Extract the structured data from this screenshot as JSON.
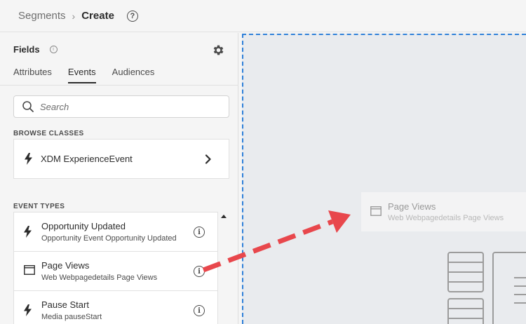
{
  "breadcrumb": {
    "parent": "Segments",
    "separator": "›",
    "current": "Create"
  },
  "fields": {
    "title": "Fields",
    "tabs": [
      {
        "label": "Attributes",
        "active": false
      },
      {
        "label": "Events",
        "active": true
      },
      {
        "label": "Audiences",
        "active": false
      }
    ],
    "search_placeholder": "Search",
    "browse_classes_label": "BROWSE CLASSES",
    "class_item": {
      "label": "XDM ExperienceEvent",
      "icon": "lightning-icon"
    },
    "event_types_label": "EVENT TYPES",
    "event_types": [
      {
        "title": "Opportunity Updated",
        "subtitle": "Opportunity Event Opportunity Updated",
        "icon": "lightning-icon"
      },
      {
        "title": "Page Views",
        "subtitle": "Web Webpagedetails Page Views",
        "icon": "window-icon"
      },
      {
        "title": "Pause Start",
        "subtitle": "Media pauseStart",
        "icon": "lightning-icon"
      }
    ]
  },
  "canvas": {
    "drag_ghost": {
      "title": "Page Views",
      "subtitle": "Web Webpagedetails Page Views",
      "icon": "window-icon"
    }
  },
  "colors": {
    "drop_zone_border": "#2f80d9",
    "annotation_arrow": "#e8474c",
    "canvas_bg": "#e9ebee"
  }
}
